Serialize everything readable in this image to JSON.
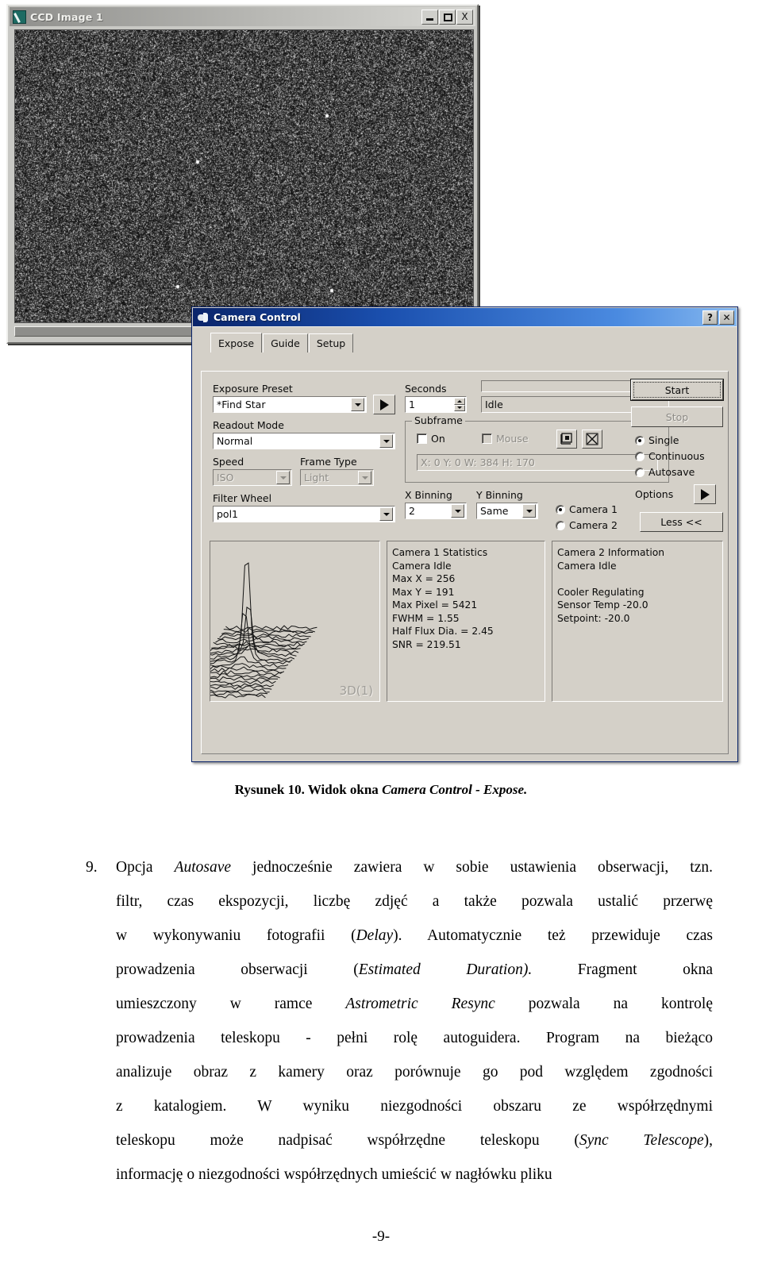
{
  "ccd_window": {
    "title": "CCD Image 1",
    "app_icon": "ccd-image-icon",
    "buttons": {
      "minimize": "_",
      "maximize": "□",
      "close": "X"
    }
  },
  "camera_window": {
    "title": "Camera Control",
    "app_icon": "camera-control-icon",
    "buttons": {
      "help": "?",
      "close": "✕"
    },
    "tabs": [
      {
        "label": "Expose",
        "active": true
      },
      {
        "label": "Guide",
        "active": false
      },
      {
        "label": "Setup",
        "active": false
      }
    ],
    "expose": {
      "exposure_preset": {
        "label": "Exposure Preset",
        "value": "*Find Star",
        "go_icon": "play-icon"
      },
      "readout_mode": {
        "label": "Readout Mode",
        "value": "Normal"
      },
      "speed": {
        "label": "Speed",
        "value": "ISO",
        "disabled": true
      },
      "frame_type": {
        "label": "Frame Type",
        "value": "Light",
        "disabled": true
      },
      "filter_wheel": {
        "label": "Filter Wheel",
        "value": "pol1"
      },
      "seconds": {
        "label": "Seconds",
        "value": "1"
      },
      "status": {
        "value": "Idle",
        "progress_percent": 0
      },
      "subframe": {
        "legend": "Subframe",
        "on_label": "On",
        "on_checked": false,
        "mouse_label": "Mouse",
        "mouse_checked": false,
        "mouse_disabled": true,
        "icon_select": "subframe-select-icon",
        "icon_fullframe": "subframe-fullframe-icon",
        "coords": "X:   0 Y:   0 W: 384 H: 170"
      },
      "x_binning": {
        "label": "X Binning",
        "value": "2"
      },
      "y_binning": {
        "label": "Y Binning",
        "value": "Same"
      },
      "camera_select": [
        {
          "label": "Camera 1",
          "selected": true
        },
        {
          "label": "Camera 2",
          "selected": false
        }
      ],
      "start_button": "Start",
      "stop_button": "Stop",
      "stop_disabled": true,
      "modes": [
        {
          "label": "Single",
          "selected": true
        },
        {
          "label": "Continuous",
          "selected": false
        },
        {
          "label": "Autosave",
          "selected": false
        }
      ],
      "options_label": "Options",
      "options_icon": "play-icon",
      "less_button": "Less <<",
      "graph": {
        "overlay_label": "3D(1)",
        "type": "3d-star-profile"
      },
      "camera1_statistics": [
        "Camera 1 Statistics",
        "Camera Idle",
        "Max X = 256",
        "Max Y = 191",
        "Max Pixel = 5421",
        "FWHM = 1.55",
        "Half Flux Dia. = 2.45",
        "SNR = 219.51"
      ],
      "camera2_information": [
        "Camera 2 Information",
        "Camera Idle",
        "",
        "Cooler Regulating",
        "Sensor Temp -20.0",
        "Setpoint: -20.0"
      ]
    }
  },
  "document": {
    "figure_caption_prefix": "Rysunek 10. Widok okna ",
    "figure_caption_italic": "Camera Control - Expose.",
    "list_number": "9.",
    "paragraph_lines": [
      "Opcja <i>Autosave</i> jednocześnie zawiera w sobie ustawienia obserwacji, tzn.",
      "filtr, czas ekspozycji, liczbę zdjęć a także pozwala ustalić przerwę",
      "w wykonywaniu fotografii (<i>Delay</i>). Automatycznie też przewiduje czas",
      "prowadzenia obserwacji (<i>Estimated Duration).</i> Fragment okna",
      "umieszczony w ramce <i>Astrometric Resync</i> pozwala na kontrolę",
      "prowadzenia teleskopu - pełni rolę autoguidera. Program na bieżąco",
      "analizuje obraz z kamery oraz porównuje go pod względem zgodności",
      "z katalogiem. W wyniku niezgodności obszaru ze współrzędnymi",
      "teleskopu może nadpisać współrzędne teleskopu (<i>Sync Telescope</i>),",
      "informację o niezgodności współrzędnych umieścić  w nagłówku pliku"
    ],
    "page_number": "-9-"
  },
  "colors": {
    "ccd_titlebar": "#b9b9b5",
    "camera_titlebar": "#1a4fae",
    "window_face": "#d4d0c8",
    "noise_background": "#0d0d0d"
  }
}
